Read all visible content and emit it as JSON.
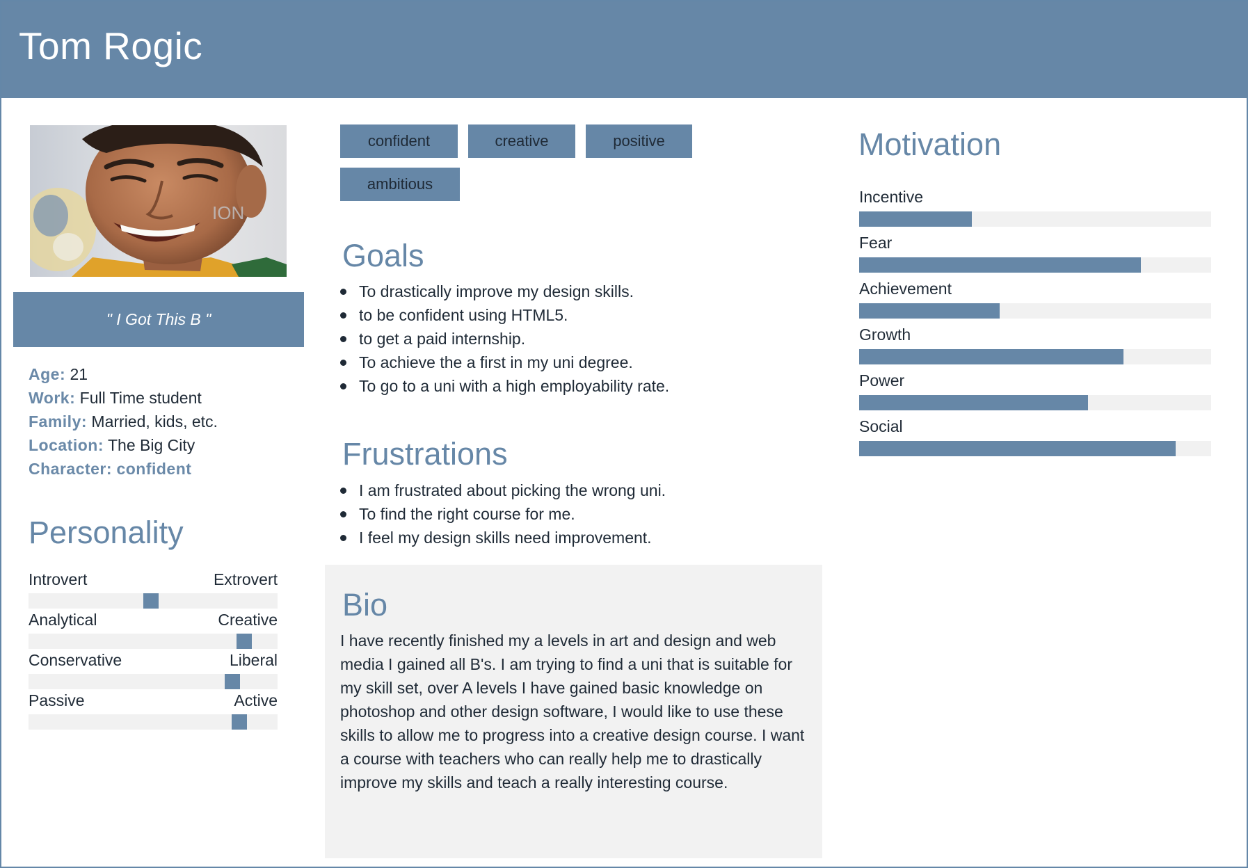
{
  "header": {
    "name": "Tom Rogic"
  },
  "profile": {
    "quote": "\" I Got This B \"",
    "facts": [
      {
        "key": "Age:",
        "value": "21"
      },
      {
        "key": "Work:",
        "value": "Full Time student"
      },
      {
        "key": "Family:",
        "value": "Married, kids, etc."
      },
      {
        "key": "Location:",
        "value": "The Big City"
      },
      {
        "key": "Character:",
        "value": "confident"
      }
    ]
  },
  "personality": {
    "title": "Personality",
    "scales": [
      {
        "left": "Introvert",
        "right": "Extrovert",
        "value": 0.49
      },
      {
        "left": "Analytical",
        "right": "Creative",
        "value": 0.89
      },
      {
        "left": "Conservative",
        "right": "Liberal",
        "value": 0.84
      },
      {
        "left": "Passive",
        "right": "Active",
        "value": 0.87
      }
    ]
  },
  "tags": [
    "confident",
    "creative",
    "positive",
    "ambitious"
  ],
  "goals": {
    "title": "Goals",
    "items": [
      "To drastically improve my design skills.",
      "to be confident using HTML5.",
      "to get a paid internship.",
      "To achieve the a first in my uni degree.",
      "To go to a uni with a high employability rate."
    ]
  },
  "frustrations": {
    "title": "Frustrations",
    "items": [
      "I am frustrated about picking the wrong uni.",
      "To find the right course for me.",
      "I feel my design skills need improvement."
    ]
  },
  "bio": {
    "title": "Bio",
    "text": "I have recently finished my a levels in art and design and web media I gained all B's. I am trying to find a uni that is suitable for my skill set, over A levels I have gained basic knowledge on photoshop and other design software, I would like to use these skills to allow me to progress into a creative design course. I want a course with teachers who can really help me to drastically improve my skills and teach a really interesting course."
  },
  "motivation": {
    "title": "Motivation",
    "bars": [
      {
        "label": "Incentive",
        "value": 0.32
      },
      {
        "label": "Fear",
        "value": 0.8
      },
      {
        "label": "Achievement",
        "value": 0.4
      },
      {
        "label": "Growth",
        "value": 0.75
      },
      {
        "label": "Power",
        "value": 0.65
      },
      {
        "label": "Social",
        "value": 0.9
      }
    ]
  },
  "colors": {
    "accent": "#6687a7",
    "track": "#f1f1f1",
    "text": "#1f2a36",
    "panel": "#f2f2f2"
  }
}
